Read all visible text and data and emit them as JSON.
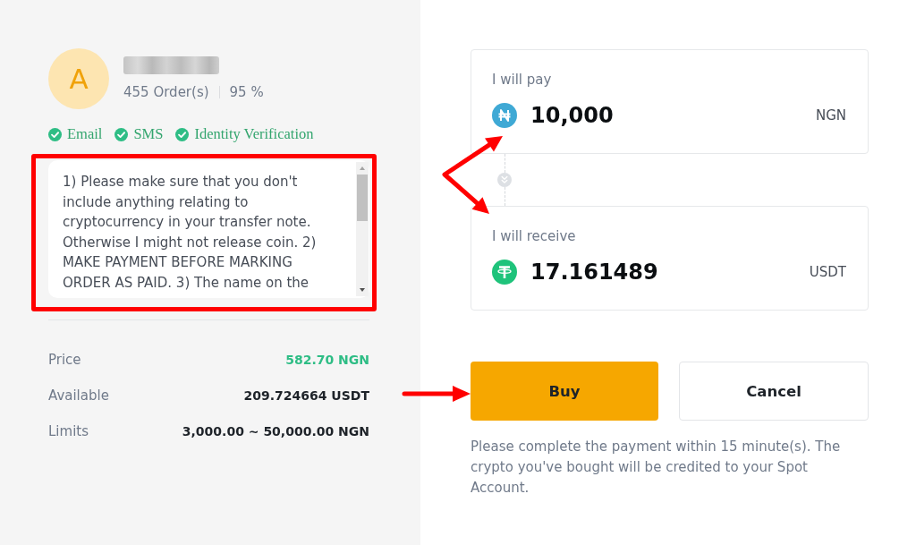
{
  "seller": {
    "avatar_letter": "A",
    "orders": "455 Order(s)",
    "completion_rate": "95 %",
    "verifications": [
      "Email",
      "SMS",
      "Identity Verification"
    ]
  },
  "terms": "1) Please make sure that you don't include anything relating to cryptocurrency in your transfer note. Otherwise I might not release coin. 2) MAKE PAYMENT BEFORE MARKING ORDER AS PAID. 3) The name on the",
  "details": [
    {
      "label": "Price",
      "value": "582.70 NGN",
      "color": "#2ebd85"
    },
    {
      "label": "Available",
      "value": "209.724664 USDT",
      "color": "#1e2329"
    },
    {
      "label": "Limits",
      "value": "3,000.00 ~ 50,000.00 NGN",
      "color": "#1e2329"
    }
  ],
  "trade": [
    {
      "label": "I will pay",
      "amount": "10,000",
      "currency": "NGN",
      "kind": "naira"
    },
    {
      "label": "I will receive",
      "amount": "17.161489",
      "currency": "USDT",
      "kind": "tether"
    }
  ],
  "buttons": [
    {
      "label": "Buy",
      "kind": "primary"
    },
    {
      "label": "Cancel",
      "kind": "secondary"
    }
  ],
  "note": "Please complete the payment within 15 minute(s). The crypto you've bought will be credited to your Spot Account."
}
